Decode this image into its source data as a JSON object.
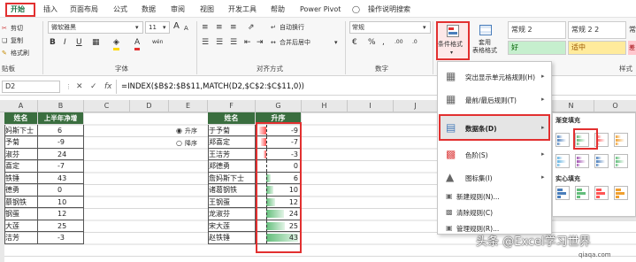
{
  "ribbon": {
    "tabs": [
      "开始",
      "插入",
      "页面布局",
      "公式",
      "数据",
      "审阅",
      "视图",
      "开发工具",
      "帮助",
      "Power Pivot",
      "操作说明搜索"
    ],
    "clipboard": {
      "cut": "剪切",
      "copy": "复制",
      "painter": "格式刷",
      "label": "贴板"
    },
    "font": {
      "name": "微软雅黑",
      "size": "11",
      "label": "字体",
      "bold": "B",
      "italic": "I",
      "underline": "U",
      "grow": "A",
      "shrink": "A",
      "color_a": "A",
      "wen": "wén"
    },
    "align": {
      "wrap": "自动换行",
      "merge": "合并后居中",
      "label": "对齐方式"
    },
    "number": {
      "format": "常规",
      "label": "数字",
      "percent": "%",
      "comma": ",",
      "dec_up": ".00",
      "dec_down": ".0"
    },
    "styles": {
      "cond": "条件格式",
      "table": "套用\n表格格式",
      "normal2": "常规 2",
      "normal22": "常规 2 2",
      "good": "好",
      "neutral": "适中",
      "label": "样式",
      "c1": "常",
      "c2": "差"
    }
  },
  "formula_bar": {
    "name_box": "D2",
    "formula": "=INDEX($B$2:$B$11,MATCH(D2,$C$2:$C$11,0))"
  },
  "columns": [
    "A",
    "B",
    "C",
    "D",
    "E",
    "F",
    "G",
    "H",
    "I",
    "J",
    "N",
    "O"
  ],
  "left_table": {
    "h1": "姓名",
    "h2": "上半年净增",
    "rows": [
      [
        "妈斯下士",
        "6"
      ],
      [
        "予菊",
        "-9"
      ],
      [
        "淑芬",
        "24"
      ],
      [
        "喜定",
        "-7"
      ],
      [
        "铁锤",
        "43"
      ],
      [
        "德勇",
        "0"
      ],
      [
        "慕钢铁",
        "10"
      ],
      [
        "钢蛋",
        "12"
      ],
      [
        "大莲",
        "25"
      ],
      [
        "洁芳",
        "-3"
      ]
    ]
  },
  "radio": {
    "asc": "升序",
    "desc": "降序"
  },
  "right_table": {
    "h1": "姓名",
    "h2": "升序",
    "rows": [
      [
        "于予菊",
        "-9"
      ],
      [
        "郑喜定",
        "-7"
      ],
      [
        "王洁芳",
        "-3"
      ],
      [
        "郑德勇",
        "0"
      ],
      [
        "詹妈斯下士",
        "6"
      ],
      [
        "诸葛钢铁",
        "10"
      ],
      [
        "王钢蛋",
        "12"
      ],
      [
        "龙淑芬",
        "24"
      ],
      [
        "宋大莲",
        "25"
      ],
      [
        "赵铁锤",
        "43"
      ]
    ]
  },
  "cf_menu": {
    "items": [
      "突出显示单元格规则(H)",
      "最前/最后规则(T)",
      "数据条(D)",
      "色阶(S)",
      "图标集(I)",
      "新建规则(N)...",
      "清除规则(C)",
      "管理规则(R)..."
    ]
  },
  "submenu": {
    "gradient": "渐变填充",
    "solid": "实心填充"
  },
  "watermark": {
    "text": "头条 @Excel学习世界",
    "site": "qiaqa.com"
  },
  "colors": {
    "accent": "#217346",
    "red": "#e23030",
    "bar": "#63be7b",
    "negbar": "#ff5555"
  }
}
